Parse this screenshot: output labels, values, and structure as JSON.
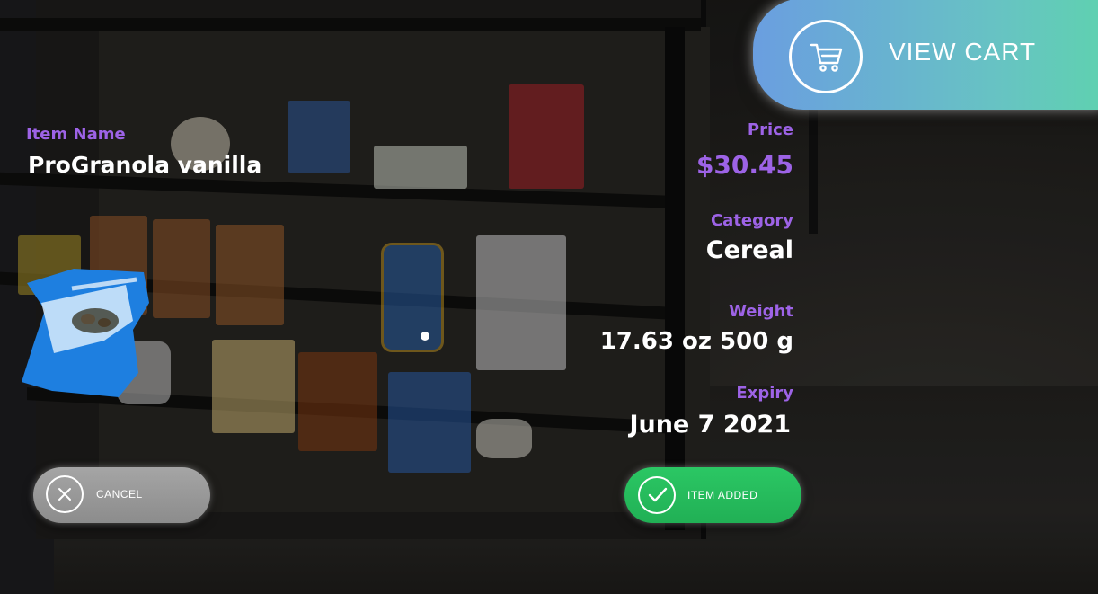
{
  "item": {
    "label": "Item Name",
    "value": "ProGranola vanilla"
  },
  "price": {
    "label": "Price",
    "value": "$30.45"
  },
  "category": {
    "label": "Category",
    "value": "Cereal"
  },
  "weight": {
    "label": "Weight",
    "value": "17.63 oz 500 g"
  },
  "expiry": {
    "label": "Expiry",
    "value": "June 7 2021"
  },
  "buttons": {
    "view_cart": "VIEW CART",
    "cancel": "CANCEL",
    "item_added": "ITEM ADDED"
  },
  "icons": {
    "cart": "shopping-cart-icon",
    "cancel": "close-icon",
    "added": "checkmark-icon"
  },
  "colors": {
    "label_purple": "#9d63e6",
    "cart_gradient_start": "#6a9ee0",
    "cart_gradient_end": "#5fd1b0",
    "cancel_gray": "#9a9a9a",
    "added_green": "#2bc764"
  }
}
